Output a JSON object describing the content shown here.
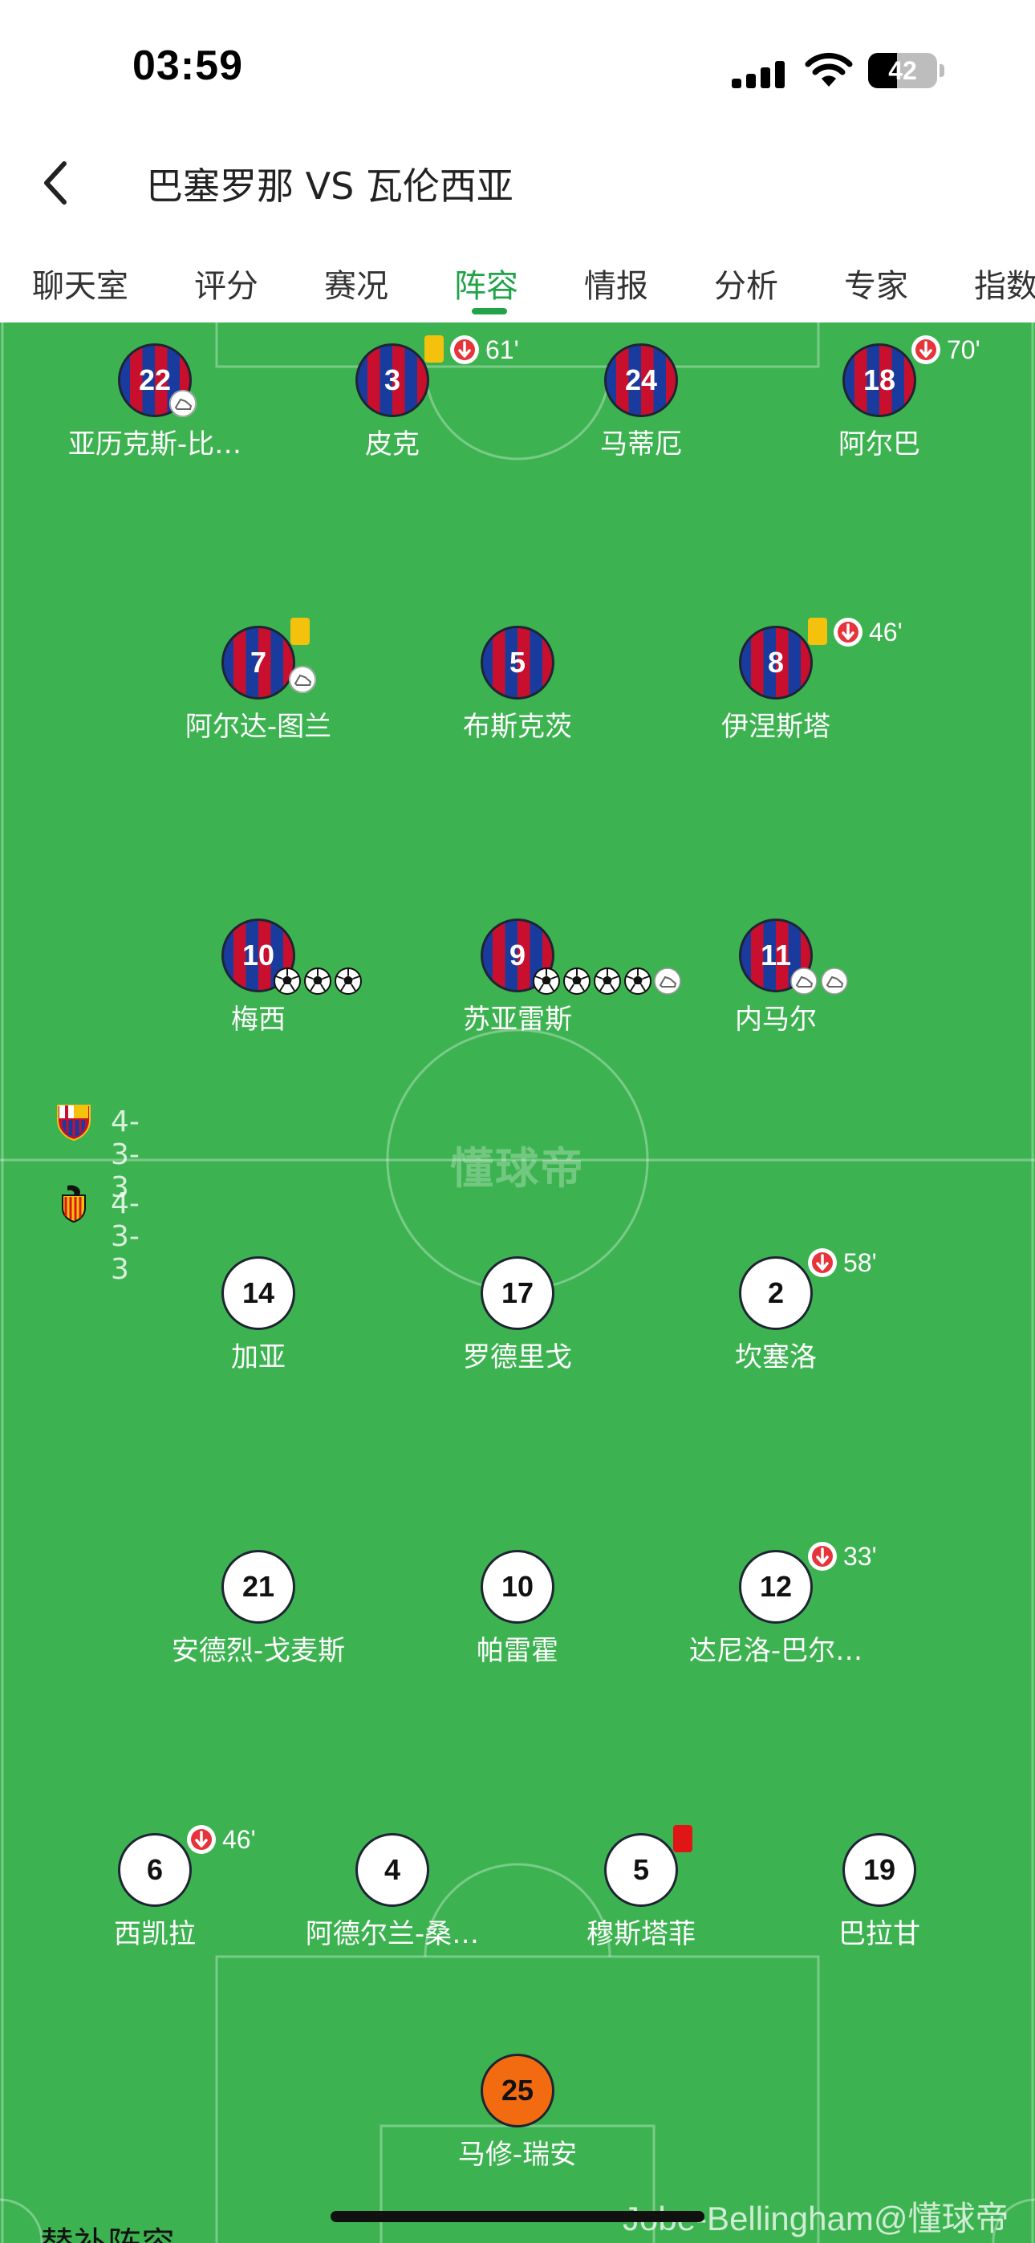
{
  "status": {
    "time": "03:59",
    "battery": "42",
    "battery_level": 0.42
  },
  "header": {
    "title": "巴塞罗那 VS 瓦伦西亚"
  },
  "tabs": [
    {
      "label": "聊天室"
    },
    {
      "label": "评分"
    },
    {
      "label": "赛况"
    },
    {
      "label": "阵容",
      "active": true
    },
    {
      "label": "情报"
    },
    {
      "label": "分析"
    },
    {
      "label": "专家"
    },
    {
      "label": "指数"
    }
  ],
  "pitch": {
    "watermark": "懂球帝",
    "home_formation": "4-3-3",
    "away_formation": "4-3-3",
    "colors": {
      "grass": "#3cb350",
      "accent": "#21a34a",
      "home_red": "#c8102e",
      "home_blue": "#1a3b9e",
      "gk": "#f26b10",
      "yellow_card": "#f4c20d",
      "red_card": "#e01515"
    }
  },
  "home_players": [
    {
      "number": "22",
      "name": "亚历克斯-比…",
      "assist": 1
    },
    {
      "number": "3",
      "name": "皮克",
      "yellow_card": true,
      "sub_out": "61'"
    },
    {
      "number": "24",
      "name": "马蒂厄"
    },
    {
      "number": "18",
      "name": "阿尔巴",
      "sub_out": "70'"
    },
    {
      "number": "7",
      "name": "阿尔达-图兰",
      "yellow_card": true,
      "assist": 1
    },
    {
      "number": "5",
      "name": "布斯克茨"
    },
    {
      "number": "8",
      "name": "伊涅斯塔",
      "yellow_card": true,
      "sub_out": "46'"
    },
    {
      "number": "10",
      "name": "梅西",
      "goals": 3
    },
    {
      "number": "9",
      "name": "苏亚雷斯",
      "goals": 4,
      "assist": 1
    },
    {
      "number": "11",
      "name": "内马尔",
      "assist": 2
    }
  ],
  "away_players": [
    {
      "number": "14",
      "name": "加亚"
    },
    {
      "number": "17",
      "name": "罗德里戈"
    },
    {
      "number": "2",
      "name": "坎塞洛",
      "sub_out": "58'"
    },
    {
      "number": "21",
      "name": "安德烈-戈麦斯"
    },
    {
      "number": "10",
      "name": "帕雷霍"
    },
    {
      "number": "12",
      "name": "达尼洛-巴尔…",
      "sub_out": "33'"
    },
    {
      "number": "6",
      "name": "西凯拉",
      "sub_out": "46'"
    },
    {
      "number": "4",
      "name": "阿德尔兰-桑…"
    },
    {
      "number": "5",
      "name": "穆斯塔菲",
      "red_card": true
    },
    {
      "number": "19",
      "name": "巴拉甘"
    },
    {
      "number": "25",
      "name": "马修-瑞安",
      "goalkeeper": true
    }
  ],
  "bottom": {
    "section_label": "替补阵容",
    "credit": "Jobe-Bellingham@懂球帝"
  }
}
